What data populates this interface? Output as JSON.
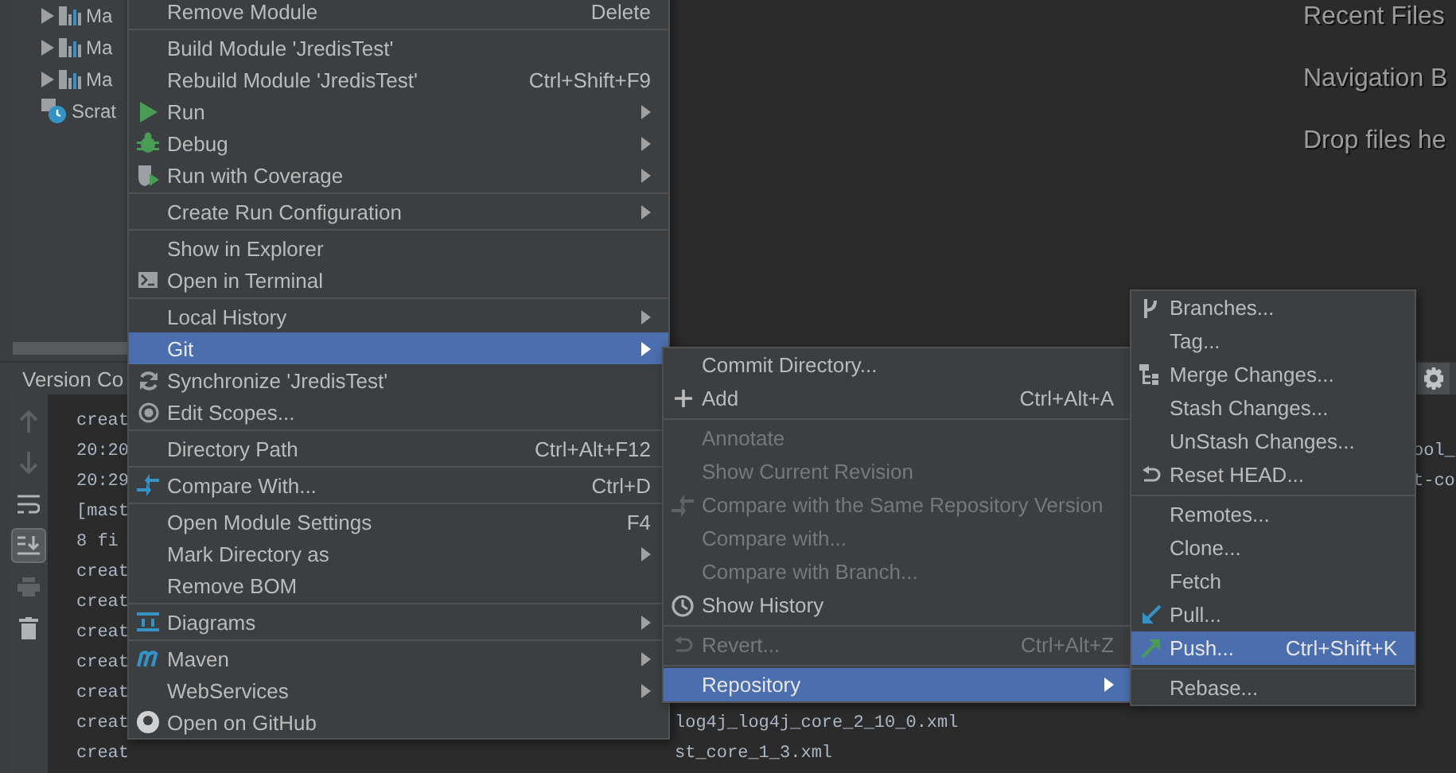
{
  "project_tree": {
    "items": [
      {
        "label": "Ma",
        "kind": "module"
      },
      {
        "label": "Ma",
        "kind": "module"
      },
      {
        "label": "Ma",
        "kind": "module"
      },
      {
        "label": "Scrat",
        "kind": "scratches"
      }
    ]
  },
  "editor_hints": [
    "Recent Files",
    "Navigation B",
    "Drop files he"
  ],
  "bottom_panel": {
    "tab": "Version Co",
    "toolbar": [
      {
        "kind": "up",
        "disabled": true,
        "selected": false
      },
      {
        "kind": "down",
        "disabled": true,
        "selected": false
      },
      {
        "kind": "wrap",
        "disabled": false,
        "selected": false
      },
      {
        "kind": "scroll-end",
        "disabled": false,
        "selected": true
      },
      {
        "kind": "print",
        "disabled": true,
        "selected": false
      },
      {
        "kind": "trash",
        "disabled": false,
        "selected": false
      }
    ],
    "console_lines": [
      {
        "column_1": "creat"
      },
      {
        "column_1": "20:20",
        "column_3": "ool_"
      },
      {
        "column_1": "20:29",
        "column_3": "t-co"
      },
      {
        "column_1": "[mast"
      },
      {
        "column_1": "8 fi"
      },
      {
        "column_1": "creat"
      },
      {
        "column_1": "creat"
      },
      {
        "column_1": "creat"
      },
      {
        "column_1": "creat"
      },
      {
        "column_1": "creat"
      },
      {
        "column_1": "creat",
        "column_2": "log4j_log4j_core_2_10_0.xml"
      },
      {
        "column_1": "creat",
        "column_2": "st_core_1_3.xml"
      }
    ]
  },
  "menus": [
    {
      "items": [
        {
          "kind": "item",
          "label": "Remove Module",
          "shortcut": "Delete",
          "has_submenu": false,
          "selected": false,
          "disabled": false
        },
        {
          "kind": "separator"
        },
        {
          "kind": "item",
          "label": "Build Module 'JredisTest'",
          "has_submenu": false,
          "selected": false,
          "disabled": false
        },
        {
          "kind": "item",
          "label": "Rebuild Module 'JredisTest'",
          "shortcut": "Ctrl+Shift+F9",
          "has_submenu": false,
          "selected": false,
          "disabled": false
        },
        {
          "kind": "item",
          "label": "Run",
          "has_submenu": true,
          "selected": false,
          "disabled": false
        },
        {
          "kind": "item",
          "label": "Debug",
          "has_submenu": true,
          "selected": false,
          "disabled": false
        },
        {
          "kind": "item",
          "label": "Run with Coverage",
          "has_submenu": true,
          "selected": false,
          "disabled": false
        },
        {
          "kind": "separator"
        },
        {
          "kind": "item",
          "label": "Create Run Configuration",
          "has_submenu": true,
          "selected": false,
          "disabled": false
        },
        {
          "kind": "separator"
        },
        {
          "kind": "item",
          "label": "Show in Explorer",
          "has_submenu": false,
          "selected": false,
          "disabled": false
        },
        {
          "kind": "item",
          "label": "Open in Terminal",
          "has_submenu": false,
          "selected": false,
          "disabled": false
        },
        {
          "kind": "separator"
        },
        {
          "kind": "item",
          "label": "Local History",
          "has_submenu": true,
          "selected": false,
          "disabled": false
        },
        {
          "kind": "item",
          "label": "Git",
          "has_submenu": true,
          "selected": true,
          "disabled": false
        },
        {
          "kind": "item",
          "label": "Synchronize 'JredisTest'",
          "has_submenu": false,
          "selected": false,
          "disabled": false
        },
        {
          "kind": "item",
          "label": "Edit Scopes...",
          "has_submenu": false,
          "selected": false,
          "disabled": false
        },
        {
          "kind": "separator"
        },
        {
          "kind": "item",
          "label": "Directory Path",
          "shortcut": "Ctrl+Alt+F12",
          "has_submenu": false,
          "selected": false,
          "disabled": false
        },
        {
          "kind": "separator"
        },
        {
          "kind": "item",
          "label": "Compare With...",
          "shortcut": "Ctrl+D",
          "has_submenu": false,
          "selected": false,
          "disabled": false
        },
        {
          "kind": "separator"
        },
        {
          "kind": "item",
          "label": "Open Module Settings",
          "shortcut": "F4",
          "has_submenu": false,
          "selected": false,
          "disabled": false
        },
        {
          "kind": "item",
          "label": "Mark Directory as",
          "has_submenu": true,
          "selected": false,
          "disabled": false
        },
        {
          "kind": "item",
          "label": "Remove BOM",
          "has_submenu": false,
          "selected": false,
          "disabled": false
        },
        {
          "kind": "separator"
        },
        {
          "kind": "item",
          "label": "Diagrams",
          "has_submenu": true,
          "selected": false,
          "disabled": false
        },
        {
          "kind": "separator"
        },
        {
          "kind": "item",
          "label": "Maven",
          "has_submenu": true,
          "selected": false,
          "disabled": false
        },
        {
          "kind": "item",
          "label": "WebServices",
          "has_submenu": true,
          "selected": false,
          "disabled": false
        },
        {
          "kind": "item",
          "label": "Open on GitHub",
          "has_submenu": false,
          "selected": false,
          "disabled": false
        }
      ]
    },
    {
      "items": [
        {
          "kind": "item",
          "label": "Commit Directory...",
          "has_submenu": false,
          "selected": false,
          "disabled": false
        },
        {
          "kind": "item",
          "label": "Add",
          "shortcut": "Ctrl+Alt+A",
          "has_submenu": false,
          "selected": false,
          "disabled": false
        },
        {
          "kind": "separator"
        },
        {
          "kind": "item",
          "label": "Annotate",
          "has_submenu": false,
          "selected": false,
          "disabled": true
        },
        {
          "kind": "item",
          "label": "Show Current Revision",
          "has_submenu": false,
          "selected": false,
          "disabled": true
        },
        {
          "kind": "item",
          "label": "Compare with the Same Repository Version",
          "has_submenu": false,
          "selected": false,
          "disabled": true
        },
        {
          "kind": "item",
          "label": "Compare with...",
          "has_submenu": false,
          "selected": false,
          "disabled": true
        },
        {
          "kind": "item",
          "label": "Compare with Branch...",
          "has_submenu": false,
          "selected": false,
          "disabled": true
        },
        {
          "kind": "item",
          "label": "Show History",
          "has_submenu": false,
          "selected": false,
          "disabled": false
        },
        {
          "kind": "separator"
        },
        {
          "kind": "item",
          "label": "Revert...",
          "shortcut": "Ctrl+Alt+Z",
          "has_submenu": false,
          "selected": false,
          "disabled": true
        },
        {
          "kind": "separator"
        },
        {
          "kind": "item",
          "label": "Repository",
          "has_submenu": true,
          "selected": true,
          "disabled": false
        }
      ]
    },
    {
      "items": [
        {
          "kind": "item",
          "label": "Branches...",
          "has_submenu": false,
          "selected": false,
          "disabled": false
        },
        {
          "kind": "item",
          "label": "Tag...",
          "has_submenu": false,
          "selected": false,
          "disabled": false
        },
        {
          "kind": "item",
          "label": "Merge Changes...",
          "has_submenu": false,
          "selected": false,
          "disabled": false
        },
        {
          "kind": "item",
          "label": "Stash Changes...",
          "has_submenu": false,
          "selected": false,
          "disabled": false
        },
        {
          "kind": "item",
          "label": "UnStash Changes...",
          "has_submenu": false,
          "selected": false,
          "disabled": false
        },
        {
          "kind": "item",
          "label": "Reset HEAD...",
          "has_submenu": false,
          "selected": false,
          "disabled": false
        },
        {
          "kind": "separator"
        },
        {
          "kind": "item",
          "label": "Remotes...",
          "has_submenu": false,
          "selected": false,
          "disabled": false
        },
        {
          "kind": "item",
          "label": "Clone...",
          "has_submenu": false,
          "selected": false,
          "disabled": false
        },
        {
          "kind": "item",
          "label": "Fetch",
          "has_submenu": false,
          "selected": false,
          "disabled": false
        },
        {
          "kind": "item",
          "label": "Pull...",
          "has_submenu": false,
          "selected": false,
          "disabled": false
        },
        {
          "kind": "item",
          "label": "Push...",
          "shortcut": "Ctrl+Shift+K",
          "has_submenu": false,
          "selected": true,
          "disabled": false
        },
        {
          "kind": "separator"
        },
        {
          "kind": "item",
          "label": "Rebase...",
          "has_submenu": false,
          "selected": false,
          "disabled": false
        }
      ]
    }
  ]
}
